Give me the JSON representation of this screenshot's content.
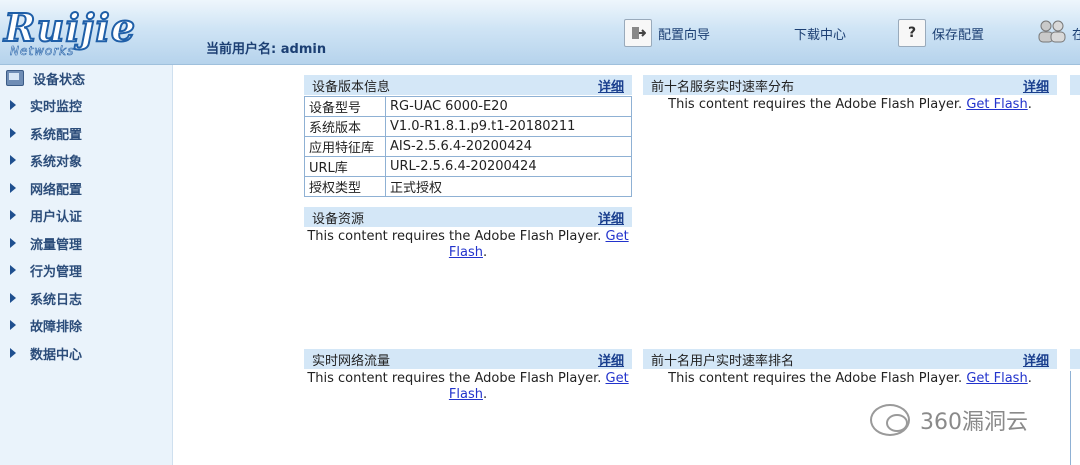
{
  "header": {
    "logo_text": "Ruijie",
    "logo_sub": "Networks",
    "user_label": "当前用户名:",
    "username": "admin",
    "buttons": [
      {
        "label": "配置向导",
        "icon": "wizard-icon"
      },
      {
        "label": "下载中心",
        "icon": ""
      },
      {
        "label": "保存配置",
        "icon": "help-icon"
      },
      {
        "label": "在",
        "icon": "users-icon"
      }
    ]
  },
  "sidebar": {
    "items": [
      {
        "label": "设备状态",
        "icon": "monitor-icon"
      },
      {
        "label": "实时监控",
        "icon": "arrow-icon"
      },
      {
        "label": "系统配置",
        "icon": "arrow-icon"
      },
      {
        "label": "系统对象",
        "icon": "arrow-icon"
      },
      {
        "label": "网络配置",
        "icon": "arrow-icon"
      },
      {
        "label": "用户认证",
        "icon": "arrow-icon"
      },
      {
        "label": "流量管理",
        "icon": "arrow-icon"
      },
      {
        "label": "行为管理",
        "icon": "arrow-icon"
      },
      {
        "label": "系统日志",
        "icon": "arrow-icon"
      },
      {
        "label": "故障排除",
        "icon": "arrow-icon"
      },
      {
        "label": "数据中心",
        "icon": "arrow-icon"
      }
    ]
  },
  "panels": {
    "version": {
      "title": "设备版本信息",
      "more": "详细",
      "rows": [
        {
          "key": "设备型号",
          "value": "RG-UAC 6000-E20"
        },
        {
          "key": "系统版本",
          "value": "V1.0-R1.8.1.p9.t1-20180211"
        },
        {
          "key": "应用特征库",
          "value": "AIS-2.5.6.4-20200424"
        },
        {
          "key": "URL库",
          "value": "URL-2.5.6.4-20200424"
        },
        {
          "key": "授权类型",
          "value": "正式授权"
        }
      ]
    },
    "resources": {
      "title": "设备资源",
      "more": "详细"
    },
    "service_rate": {
      "title": "前十名服务实时速率分布",
      "more": "详细"
    },
    "traffic": {
      "title": "实时网络流量",
      "more": "详细"
    },
    "user_rate": {
      "title": "前十名用户实时速率排名",
      "more": "详细"
    }
  },
  "flash": {
    "text": "This content requires the Adobe Flash Player.",
    "link_get": "Get",
    "link_flash": "Flash",
    "link_get_flash": "Get Flash"
  },
  "watermark": "360漏洞云"
}
